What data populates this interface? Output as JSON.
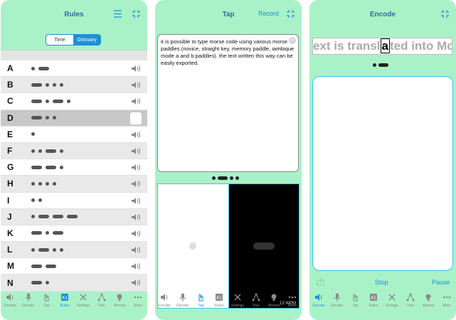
{
  "colors": {
    "accent": "#1f8fd6",
    "bg": "#a9f2c8"
  },
  "screen1": {
    "title": "Rules",
    "segments": [
      "Time",
      "Glossary"
    ],
    "rows": [
      {
        "letter": "A",
        "code": ".-"
      },
      {
        "letter": "B",
        "code": "-..."
      },
      {
        "letter": "C",
        "code": "-.-."
      },
      {
        "letter": "D",
        "code": "-.."
      },
      {
        "letter": "E",
        "code": "."
      },
      {
        "letter": "F",
        "code": "..-."
      },
      {
        "letter": "G",
        "code": "--."
      },
      {
        "letter": "H",
        "code": "...."
      },
      {
        "letter": "I",
        "code": ".."
      },
      {
        "letter": "J",
        "code": ".---"
      },
      {
        "letter": "K",
        "code": "-.-"
      },
      {
        "letter": "L",
        "code": ".-.."
      },
      {
        "letter": "M",
        "code": "--"
      },
      {
        "letter": "N",
        "code": "-."
      }
    ],
    "selected_row": "D"
  },
  "screen2": {
    "title": "Tap",
    "record": "Record",
    "text": "it is possible to type morse code using various morse paddles (novice, straight key, memory paddle, iambique mode a and b paddles). the text written this way can be easily exported.",
    "wpm": "13 WPM"
  },
  "screen3": {
    "title": "Encode",
    "scroll_before": "ext is transl",
    "scroll_cursor": "a",
    "scroll_after": "ted into Mo",
    "stop": "Stop",
    "pause": "Pause"
  },
  "tabs": [
    {
      "label": "Encode",
      "icon": "speaker-icon"
    },
    {
      "label": "Decode",
      "icon": "microphone-icon"
    },
    {
      "label": "Tap",
      "icon": "hand-icon"
    },
    {
      "label": "Rules",
      "icon": "rules-icon"
    },
    {
      "label": "Settings",
      "icon": "tools-icon"
    },
    {
      "label": "Tree",
      "icon": "tree-icon"
    },
    {
      "label": "Mnemo",
      "icon": "bulb-icon"
    },
    {
      "label": "More",
      "icon": "more-icon"
    }
  ]
}
